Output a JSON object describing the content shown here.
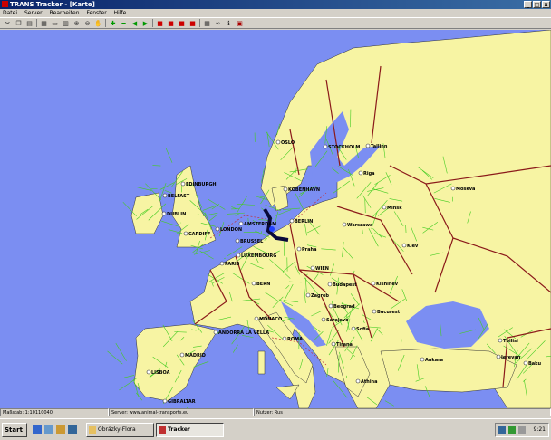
{
  "window": {
    "title": "TRANS Tracker - [Karte]"
  },
  "menu": [
    "Datei",
    "Server",
    "Bearbeiten",
    "Fenster",
    "Hilfe"
  ],
  "toolbar_icons": [
    "cut-icon",
    "copy-icon",
    "paste-icon",
    "window-icon",
    "window2-icon",
    "layers-icon",
    "zoom-in-icon",
    "zoom-out-icon",
    "pan-icon",
    "add-icon",
    "remove-icon",
    "back-icon",
    "forward-icon",
    "truck-icon",
    "truck2-icon",
    "truck3-icon",
    "truck4-icon",
    "grid-icon",
    "binoculars-icon",
    "info-icon",
    "report-icon"
  ],
  "colors": {
    "sea": "#7b8ef2",
    "land": "#f7f4a3",
    "border": "#8b1a1a",
    "road": "#44cc22",
    "route": "#0a0a3a"
  },
  "cities": [
    {
      "name": "OSLO"
    },
    {
      "name": "STOCKHOLM"
    },
    {
      "name": "Tallinn"
    },
    {
      "name": "Riga"
    },
    {
      "name": "Moskva"
    },
    {
      "name": "KOBENHAVN"
    },
    {
      "name": "EDINBURGH"
    },
    {
      "name": "BELFAST"
    },
    {
      "name": "DUBLIN"
    },
    {
      "name": "CARDIFF"
    },
    {
      "name": "LONDON"
    },
    {
      "name": "AMSTERDAM"
    },
    {
      "name": "BERLIN"
    },
    {
      "name": "Warszawa"
    },
    {
      "name": "Minsk"
    },
    {
      "name": "Kiev"
    },
    {
      "name": "BRUSSEL"
    },
    {
      "name": "Praha"
    },
    {
      "name": "LUXEMBOURG"
    },
    {
      "name": "PARIS"
    },
    {
      "name": "WIEN"
    },
    {
      "name": "BERN"
    },
    {
      "name": "Budapest"
    },
    {
      "name": "Kishinev"
    },
    {
      "name": "Zagreb"
    },
    {
      "name": "Beograd"
    },
    {
      "name": "Bucurest"
    },
    {
      "name": "MONACO"
    },
    {
      "name": "Sarajevo"
    },
    {
      "name": "Sofia"
    },
    {
      "name": "ANDORRA LA VELLA"
    },
    {
      "name": "ROMA"
    },
    {
      "name": "Tirana"
    },
    {
      "name": "Tbilisi"
    },
    {
      "name": "Jerevan"
    },
    {
      "name": "Baku"
    },
    {
      "name": "MADRID"
    },
    {
      "name": "Ankara"
    },
    {
      "name": "LISBOA"
    },
    {
      "name": "Athina"
    },
    {
      "name": "GIBRALTAR"
    }
  ],
  "status": {
    "scale": "Maßstab: 1:10110040",
    "server": "Server: www.animal-transports.eu",
    "user": "Nutzer: Rus"
  },
  "taskbar": {
    "start": "Start",
    "tasks": [
      "Obrázky-Flora",
      "Tracker"
    ],
    "clock": "9:21"
  }
}
